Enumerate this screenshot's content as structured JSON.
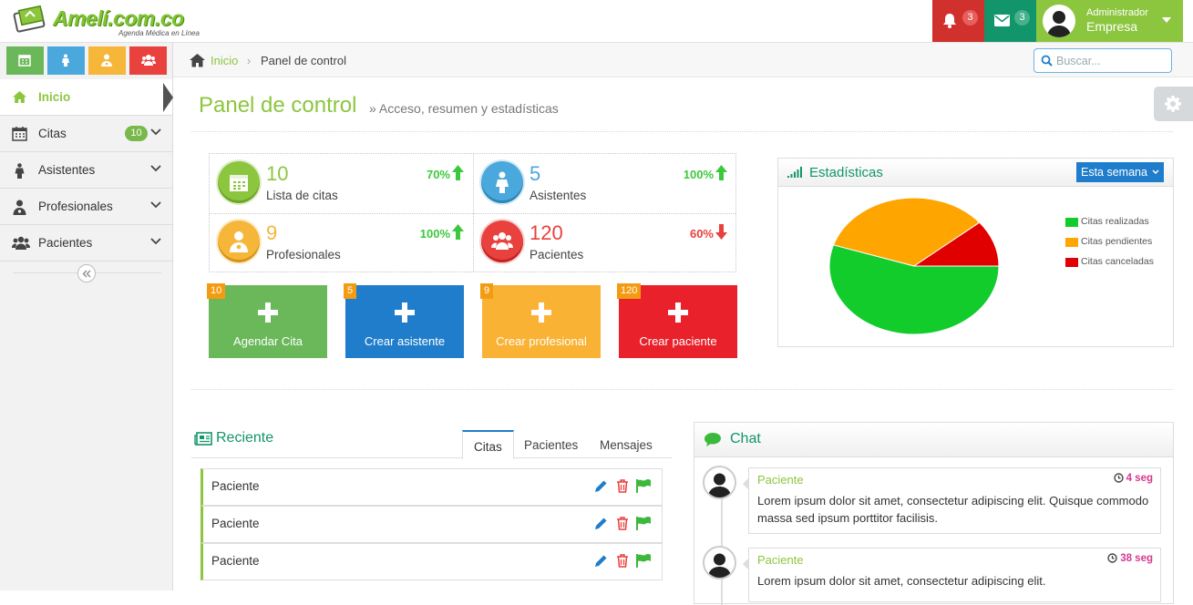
{
  "brand": {
    "name": "Amelí.com.co",
    "tagline": "Agenda Médica en Línea"
  },
  "topnav": {
    "notifications_count": "3",
    "messages_count": "3",
    "user_role": "Administrador",
    "user_name": "Empresa"
  },
  "shortcuts": [
    {
      "icon": "calendar-icon",
      "color": "#6ab85a"
    },
    {
      "icon": "assistant-icon",
      "color": "#4aa8dc"
    },
    {
      "icon": "doctor-icon",
      "color": "#f5b63a"
    },
    {
      "icon": "patients-icon",
      "color": "#e8413e"
    }
  ],
  "sidebar": {
    "items": [
      {
        "label": "Inicio",
        "icon": "home-icon",
        "active": true
      },
      {
        "label": "Citas",
        "icon": "calendar-icon",
        "count": "10"
      },
      {
        "label": "Asistentes",
        "icon": "assistant-icon"
      },
      {
        "label": "Profesionales",
        "icon": "doctor-icon"
      },
      {
        "label": "Pacientes",
        "icon": "patients-icon"
      }
    ]
  },
  "breadcrumb": {
    "home": "Inicio",
    "separator": "›",
    "current": "Panel de control"
  },
  "search": {
    "placeholder": "Buscar..."
  },
  "page": {
    "title": "Panel de control",
    "subtitle": "» Acceso, resumen y estadísticas"
  },
  "stats": [
    {
      "value": "10",
      "label": "Lista de citas",
      "percent": "70%",
      "trend": "up",
      "color": "#8cc63f"
    },
    {
      "value": "5",
      "label": "Asistentes",
      "percent": "100%",
      "trend": "up",
      "color": "#4aa8dc"
    },
    {
      "value": "9",
      "label": "Profesionales",
      "percent": "100%",
      "trend": "up",
      "color": "#f5b63a"
    },
    {
      "value": "120",
      "label": "Pacientes",
      "percent": "60%",
      "trend": "down",
      "color": "#e8413e"
    }
  ],
  "quick_actions": [
    {
      "badge": "10",
      "label": "Agendar Cita",
      "color": "#6ab85a"
    },
    {
      "badge": "5",
      "label": "Crear asistente",
      "color": "#1f7dcb"
    },
    {
      "badge": "9",
      "label": "Crear profesional",
      "color": "#f9b233"
    },
    {
      "badge": "120",
      "label": "Crear paciente",
      "color": "#e8212a"
    }
  ],
  "statistics": {
    "title": "Estadísticas",
    "period_label": "Esta semana"
  },
  "chart_data": {
    "type": "pie",
    "labels": [
      "Citas realizadas",
      "Citas pendientes",
      "Citas canceladas"
    ],
    "values": [
      55,
      34,
      11
    ],
    "colors": [
      "#12cc2c",
      "#ffa500",
      "#e00000"
    ]
  },
  "recent": {
    "title": "Reciente",
    "tabs": [
      "Citas",
      "Pacientes",
      "Mensajes"
    ],
    "rows": [
      "Paciente",
      "Paciente",
      "Paciente"
    ]
  },
  "chat": {
    "title": "Chat",
    "messages": [
      {
        "name": "Paciente",
        "time": "4 seg",
        "text": "Lorem ipsum dolor sit amet, consectetur adipiscing elit. Quisque commodo massa sed ipsum porttitor facilisis."
      },
      {
        "name": "Paciente",
        "time": "38 seg",
        "text": "Lorem ipsum dolor sit amet, consectetur adipiscing elit."
      }
    ]
  }
}
